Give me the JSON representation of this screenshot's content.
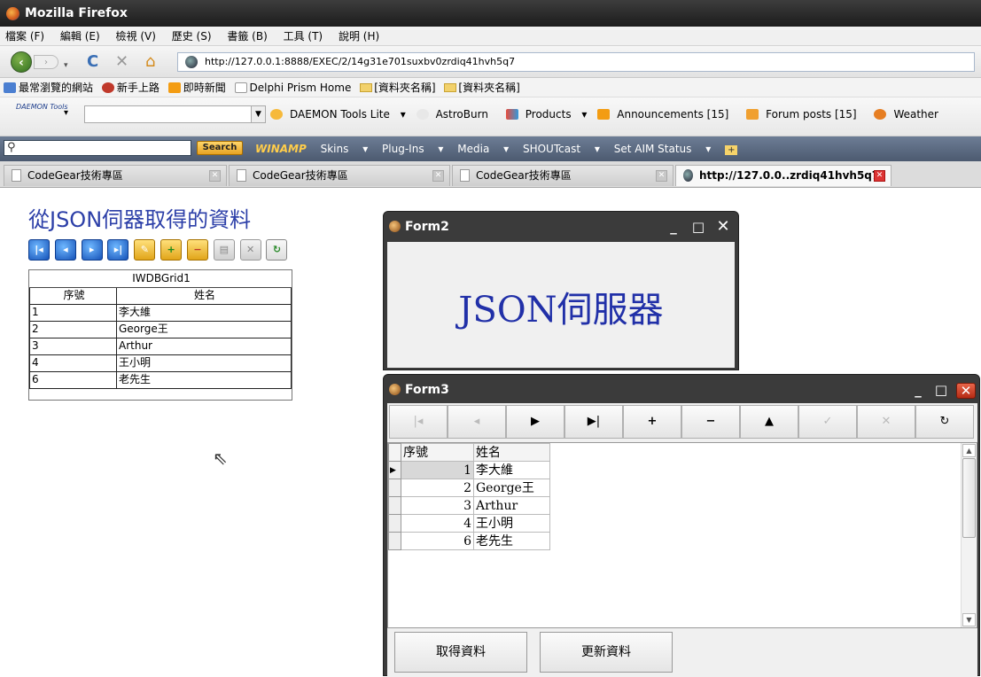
{
  "browser": {
    "title": "Mozilla Firefox",
    "menu": [
      "檔案 (F)",
      "編輯 (E)",
      "檢視 (V)",
      "歷史 (S)",
      "書籤 (B)",
      "工具 (T)",
      "說明 (H)"
    ],
    "url": "http://127.0.0.1:8888/EXEC/2/14g31e701suxbv0zrdiq41hvh5q7",
    "bookmarks": [
      "最常瀏覽的網站",
      "新手上路",
      "即時新聞",
      "Delphi Prism Home",
      "[資料夾名稱]",
      "[資料夾名稱]"
    ],
    "daemon": {
      "logo": "DAEMON Tools",
      "items": [
        "DAEMON Tools Lite",
        "AstroBurn",
        "Products",
        "Announcements [15]",
        "Forum posts [15]",
        "Weather"
      ]
    },
    "winamp": {
      "search_label": "Search",
      "logo": "WINAMP",
      "items": [
        "Skins",
        "Plug-Ins",
        "Media",
        "SHOUTcast",
        "Set AIM Status"
      ]
    },
    "tabs": [
      {
        "label": "CodeGear技術專區"
      },
      {
        "label": "CodeGear技術專區"
      },
      {
        "label": "CodeGear技術專區"
      },
      {
        "label": "http://127.0.0..zrdiq41hvh5q7"
      }
    ]
  },
  "page": {
    "heading": "從JSON伺器取得的資料",
    "grid": {
      "caption": "IWDBGrid1",
      "headers": [
        "序號",
        "姓名"
      ],
      "rows": [
        [
          "1",
          "李大維"
        ],
        [
          "2",
          "George王"
        ],
        [
          "3",
          "Arthur"
        ],
        [
          "4",
          "王小明"
        ],
        [
          "6",
          "老先生"
        ]
      ]
    }
  },
  "form2": {
    "title": "Form2",
    "label": "JSON伺服器"
  },
  "form3": {
    "title": "Form3",
    "grid_headers": [
      "序號",
      "姓名"
    ],
    "grid_rows": [
      [
        "1",
        "李大維"
      ],
      [
        "2",
        "George王"
      ],
      [
        "3",
        "Arthur"
      ],
      [
        "4",
        "王小明"
      ],
      [
        "6",
        "老先生"
      ]
    ],
    "buttons": {
      "get": "取得資料",
      "update": "更新資料"
    }
  }
}
